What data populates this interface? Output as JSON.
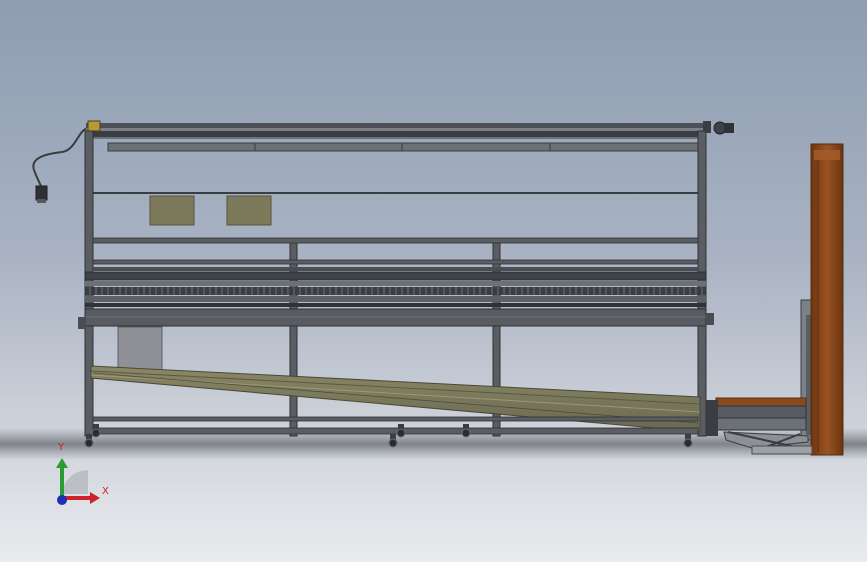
{
  "triad": {
    "x_label": "X",
    "y_label": "Y"
  },
  "colors": {
    "frame": "#55585d",
    "frame_dark": "#2f3236",
    "panel_olive": "#7d7a5c",
    "box_gray": "#8f9196",
    "wood": "#8b4a1c",
    "wood_edge": "#5a2c0c",
    "axis_x": "#d0202a",
    "axis_y": "#2a9b35",
    "axis_z": "#1d2fb8"
  }
}
